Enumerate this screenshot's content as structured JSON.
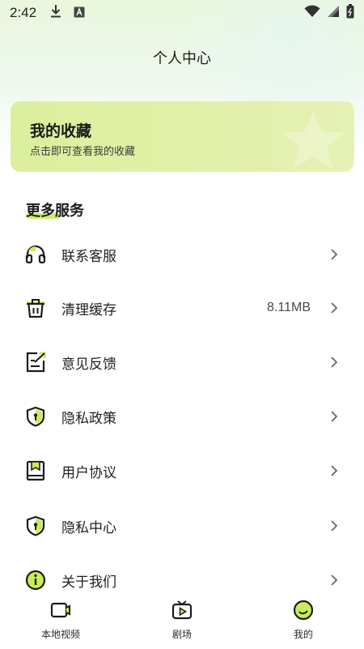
{
  "status_bar": {
    "time": "2:42",
    "icons": [
      "download-icon",
      "font-a-icon",
      "wifi-icon",
      "signal-icon",
      "battery-icon"
    ]
  },
  "header": {
    "title": "个人中心"
  },
  "favorites": {
    "title": "我的收藏",
    "subtitle": "点击即可查看我的收藏"
  },
  "services": {
    "title": "更多服务",
    "items": [
      {
        "label": "联系客服",
        "value": "",
        "icon": "headset-icon"
      },
      {
        "label": "清理缓存",
        "value": "8.11MB",
        "icon": "trash-icon"
      },
      {
        "label": "意见反馈",
        "value": "",
        "icon": "feedback-icon"
      },
      {
        "label": "隐私政策",
        "value": "",
        "icon": "shield-icon"
      },
      {
        "label": "用户协议",
        "value": "",
        "icon": "book-icon"
      },
      {
        "label": "隐私中心",
        "value": "",
        "icon": "shield-icon"
      },
      {
        "label": "关于我们",
        "value": "",
        "icon": "info-icon"
      }
    ]
  },
  "bottom_nav": {
    "items": [
      {
        "label": "本地视频",
        "icon": "video-folder-icon"
      },
      {
        "label": "剧场",
        "icon": "tv-play-icon"
      },
      {
        "label": "我的",
        "icon": "smile-icon",
        "active": true
      }
    ]
  },
  "colors": {
    "accent": "#c8ec5a",
    "card": "#dcef9d",
    "icon_stroke": "#1c1c1c"
  }
}
